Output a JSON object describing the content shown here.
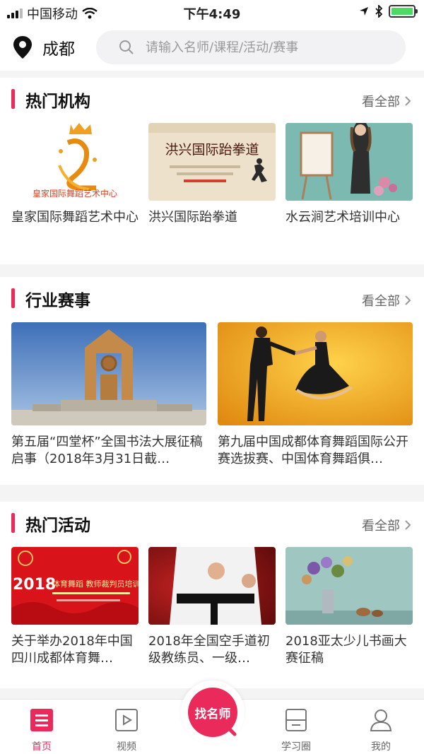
{
  "status_bar": {
    "carrier": "中国移动",
    "time": "下午4:49",
    "battery_percent": 100
  },
  "header": {
    "city": "成都",
    "search_placeholder": "请输入名师/课程/活动/赛事"
  },
  "sections": {
    "institutions": {
      "title": "热门机构",
      "more": "看全部",
      "items": [
        {
          "name": "皇家国际舞蹈艺术中心",
          "logo_text": "皇家国际舞蹈艺术中心"
        },
        {
          "name": "洪兴国际跆拳道",
          "logo_text": "洪兴国际跆拳道"
        },
        {
          "name": "水云涧艺术培训中心"
        }
      ]
    },
    "competitions": {
      "title": "行业赛事",
      "more": "看全部",
      "items": [
        {
          "name": "第五届“四堂杯”全国书法大展征稿启事（2018年3月31日截…"
        },
        {
          "name": "第九届中国成都体育舞蹈国际公开赛选拔赛、中国体育舞蹈俱…"
        }
      ]
    },
    "activities": {
      "title": "热门活动",
      "more": "看全部",
      "items": [
        {
          "name": "关于举办2018年中国四川成都体育舞…",
          "banner_year": "2018",
          "banner_text": "体育舞蹈 教师裁判员培训"
        },
        {
          "name": "2018年全国空手道初级教练员、一级…"
        },
        {
          "name": "2018亚太少儿书画大赛征稿"
        }
      ]
    }
  },
  "tabbar": {
    "home": "首页",
    "video": "视频",
    "find_teacher": "找名师",
    "study_circle": "学习圈",
    "mine": "我的"
  },
  "colors": {
    "accent": "#ea2a5a"
  }
}
